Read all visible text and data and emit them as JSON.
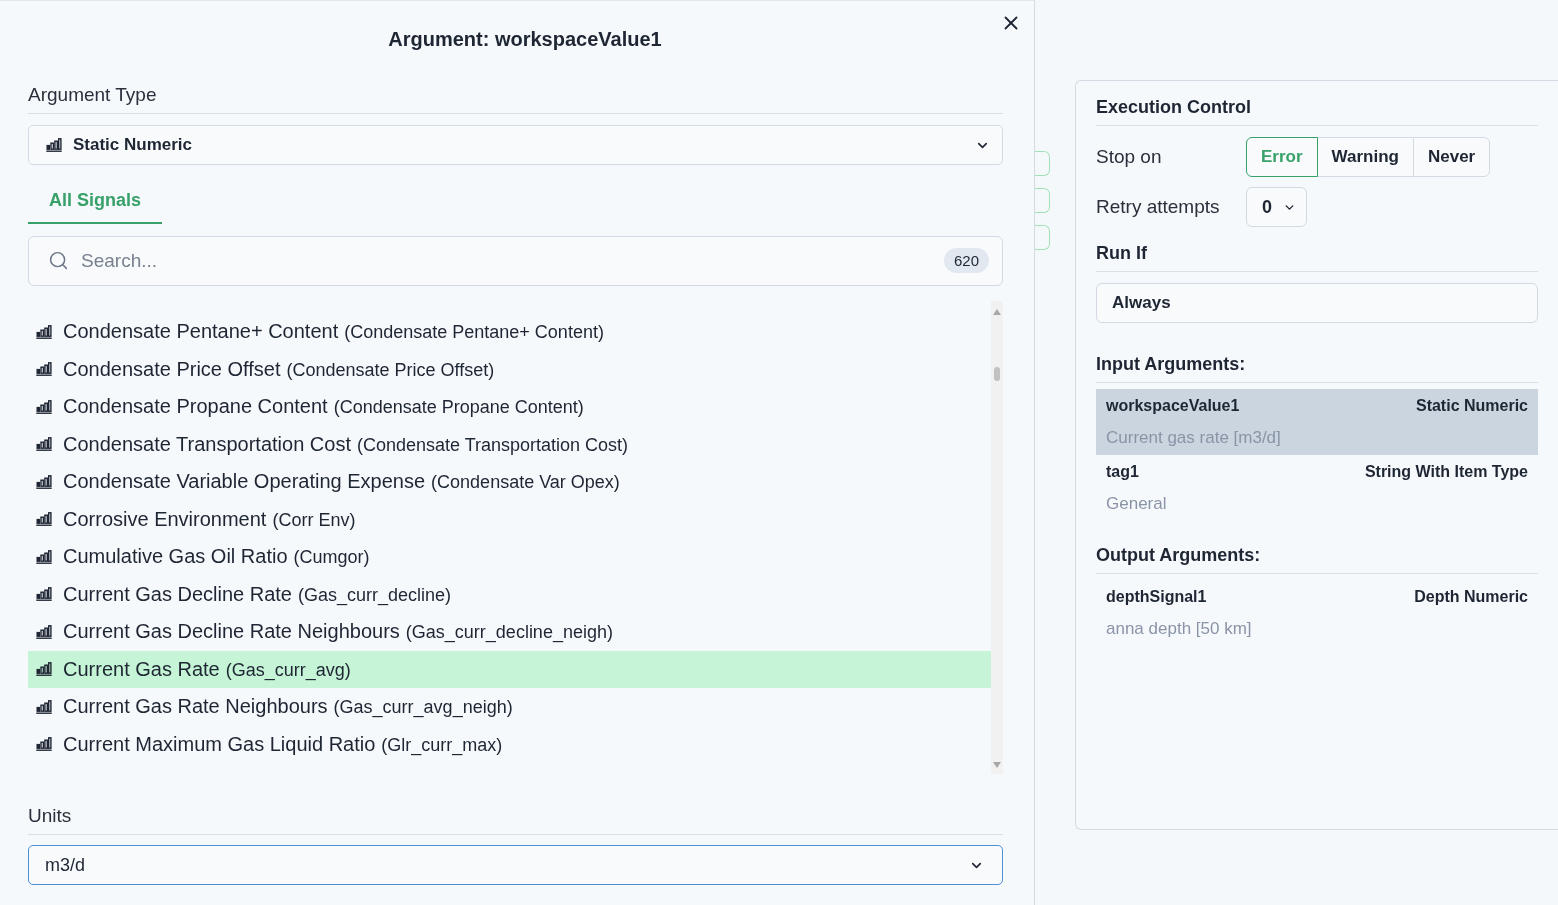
{
  "dialog": {
    "title": "Argument: workspaceValue1",
    "argument_type": {
      "label": "Argument Type",
      "value": "Static Numeric"
    },
    "tabs": [
      {
        "label": "All Signals",
        "selected": true
      }
    ],
    "search": {
      "placeholder": "Search...",
      "count": "620"
    },
    "signals": [
      {
        "name": "Condensate Pentane+ Content",
        "code": "(Condensate Pentane+ Content)",
        "selected": false
      },
      {
        "name": "Condensate Price Offset",
        "code": "(Condensate Price Offset)",
        "selected": false
      },
      {
        "name": "Condensate Propane Content",
        "code": "(Condensate Propane Content)",
        "selected": false
      },
      {
        "name": "Condensate Transportation Cost",
        "code": "(Condensate Transportation Cost)",
        "selected": false
      },
      {
        "name": "Condensate Variable Operating Expense",
        "code": "(Condensate Var Opex)",
        "selected": false
      },
      {
        "name": "Corrosive Environment",
        "code": "(Corr Env)",
        "selected": false
      },
      {
        "name": "Cumulative Gas Oil Ratio",
        "code": "(Cumgor)",
        "selected": false
      },
      {
        "name": "Current Gas Decline Rate",
        "code": "(Gas_curr_decline)",
        "selected": false
      },
      {
        "name": "Current Gas Decline Rate Neighbours",
        "code": "(Gas_curr_decline_neigh)",
        "selected": false
      },
      {
        "name": "Current Gas Rate",
        "code": "(Gas_curr_avg)",
        "selected": true
      },
      {
        "name": "Current Gas Rate Neighbours",
        "code": "(Gas_curr_avg_neigh)",
        "selected": false
      },
      {
        "name": "Current Maximum Gas Liquid Ratio",
        "code": "(Glr_curr_max)",
        "selected": false
      }
    ],
    "units": {
      "label": "Units",
      "value": "m3/d",
      "focused": true
    }
  },
  "execution_control": {
    "title": "Execution Control",
    "stop_on": {
      "label": "Stop on",
      "options": [
        {
          "label": "Error",
          "selected": true
        },
        {
          "label": "Warning",
          "selected": false
        },
        {
          "label": "Never",
          "selected": false
        }
      ]
    },
    "retry_attempts": {
      "label": "Retry attempts",
      "value": "0"
    },
    "run_if": {
      "title": "Run If",
      "value": "Always"
    },
    "input_arguments": {
      "title": "Input Arguments:",
      "items": [
        {
          "name": "workspaceValue1",
          "type": "Static Numeric",
          "description": "Current gas rate [m3/d]",
          "selected": true
        },
        {
          "name": "tag1",
          "type": "String With Item Type",
          "description": "General",
          "selected": false
        }
      ]
    },
    "output_arguments": {
      "title": "Output Arguments:",
      "items": [
        {
          "name": "depthSignal1",
          "type": "Depth Numeric",
          "description": "anna depth [50 km]",
          "selected": false
        }
      ]
    }
  }
}
